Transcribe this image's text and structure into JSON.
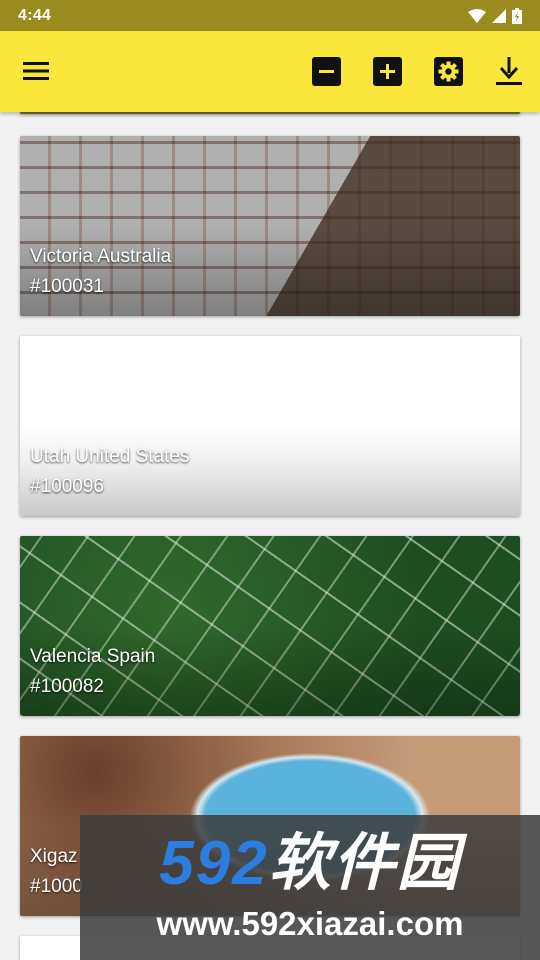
{
  "status_bar": {
    "time": "4:44"
  },
  "toolbar": {
    "icons": [
      "menu-icon",
      "zoom-out-icon",
      "zoom-in-icon",
      "settings-icon",
      "download-icon"
    ]
  },
  "cards": [
    {
      "title": "Victoria Australia",
      "code": "#100031"
    },
    {
      "title": "Utah United States",
      "code": "#100096"
    },
    {
      "title": "Valencia Spain",
      "code": "#100082"
    },
    {
      "title": "Xigaz",
      "code": "#1000"
    }
  ],
  "watermark": {
    "brand": "592",
    "brand_cn": "软件园",
    "url": "www.592xiazai.com"
  },
  "colors": {
    "status_bar": "#9b8a1e",
    "toolbar": "#fbe73b"
  }
}
